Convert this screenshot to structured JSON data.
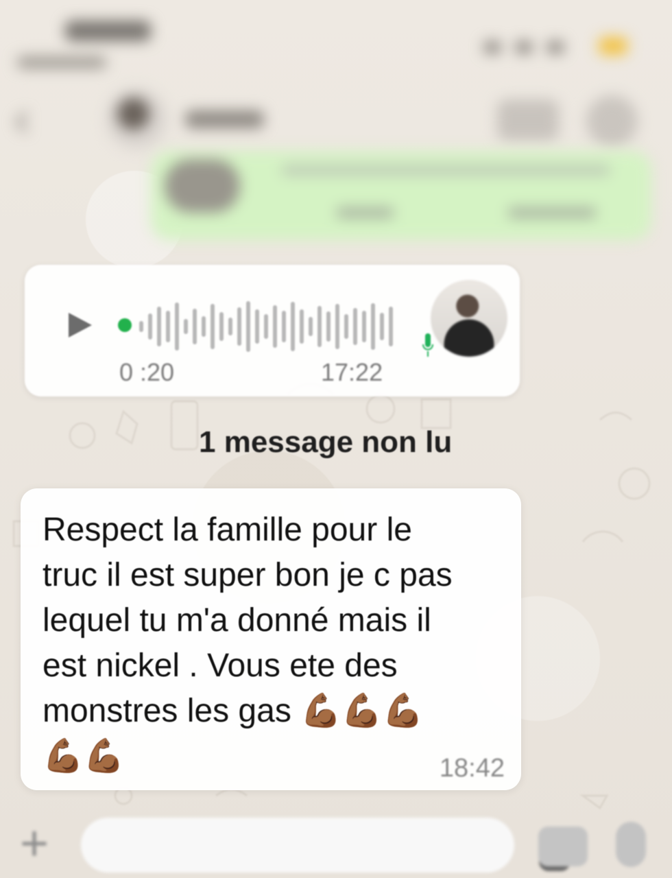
{
  "voice_message": {
    "duration": "0 :20",
    "time": "17:22"
  },
  "divider": {
    "unread": "1 message non lu"
  },
  "incoming_message": {
    "text": "Respect la famille pour le\ntruc il est super bon je c pas\nlequel tu m'a donné mais il\nest nickel . Vous ete des\nmonstres les gas 💪🏾💪🏾💪🏾\n💪🏾💪🏾",
    "time": "18:42"
  },
  "colors": {
    "chat_background": "#ebe6df",
    "incoming_bubble": "#ffffff",
    "outgoing_bubble": "#d5f3c4",
    "voice_progress": "#22b14c",
    "secondary_text": "#888888"
  },
  "icons": {
    "play": "play-icon",
    "mic": "mic-icon",
    "add": "plus-icon",
    "sticker": "sticker-icon",
    "camera": "camera-icon",
    "bottom_mic": "microphone-icon"
  }
}
